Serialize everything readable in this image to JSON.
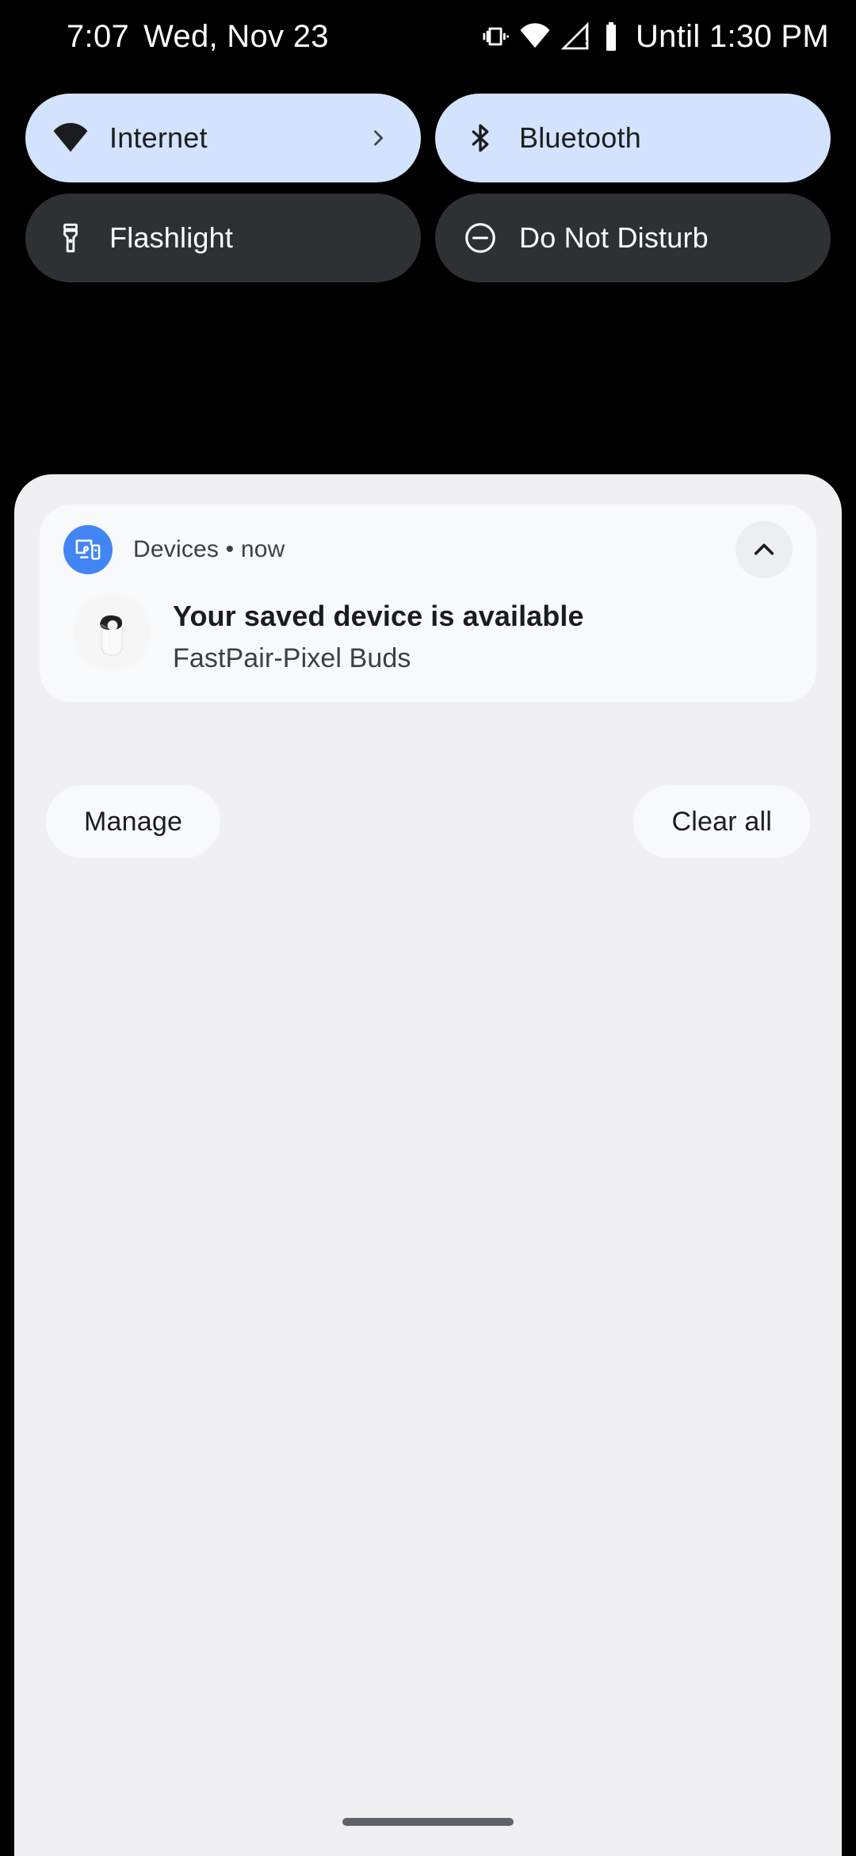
{
  "status_bar": {
    "clock": "7:07",
    "date": "Wed, Nov 23",
    "dnd_until": "Until 1:30 PM",
    "icons": [
      "vibrate-icon",
      "wifi-icon",
      "no-sim-signal-icon",
      "battery-icon"
    ]
  },
  "quick_settings": {
    "tiles": [
      {
        "label": "Internet",
        "icon": "wifi-icon",
        "state": "active",
        "has_chevron": true
      },
      {
        "label": "Bluetooth",
        "icon": "bluetooth-icon",
        "state": "active",
        "has_chevron": false
      },
      {
        "label": "Flashlight",
        "icon": "flashlight-icon",
        "state": "inactive",
        "has_chevron": false
      },
      {
        "label": "Do Not Disturb",
        "icon": "do-not-disturb-icon",
        "state": "inactive",
        "has_chevron": false
      }
    ],
    "active_color": "#D3E3FD",
    "inactive_color": "#2E3133"
  },
  "notification": {
    "app_name": "Devices",
    "separator": "•",
    "time": "now",
    "header_line": "Devices • now",
    "title": "Your saved device is available",
    "subtitle": "FastPair-Pixel Buds",
    "badge_icon": "devices-cast-icon",
    "badge_color": "#4285F4",
    "collapse_icon": "chevron-up-icon",
    "device_image": "pixel-buds-case-image"
  },
  "shade_footer": {
    "manage_label": "Manage",
    "clear_all_label": "Clear all"
  },
  "navigation": {
    "gesture_hint": "home-gesture-bar"
  }
}
